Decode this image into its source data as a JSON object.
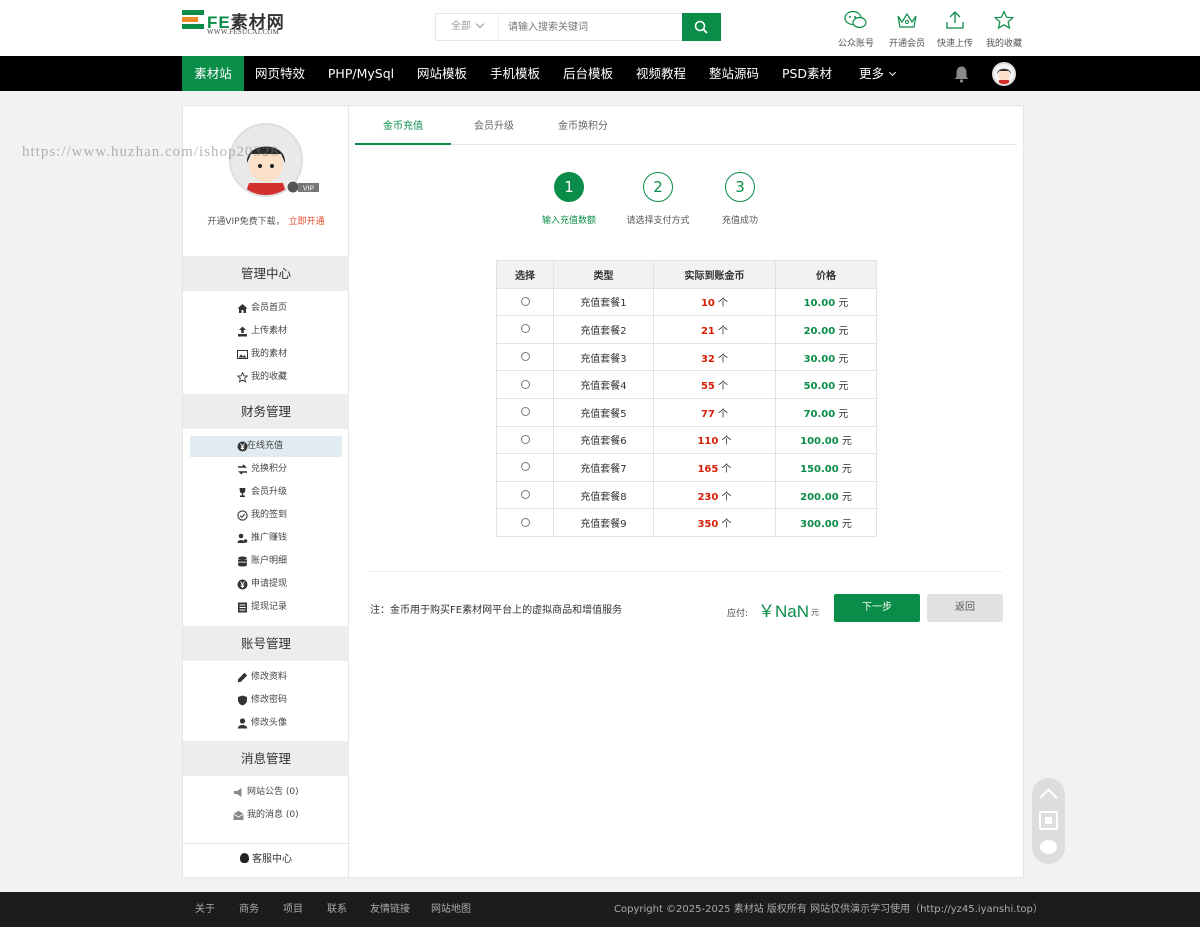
{
  "header": {
    "logo_text_fe": "FE",
    "logo_text_cn": "素材网",
    "logo_sub": "WWW.FESUCAI.COM",
    "search": {
      "category": "全部",
      "placeholder": "请输入搜索关键词"
    },
    "tools": [
      {
        "label": "公众账号",
        "icon": "wechat-icon"
      },
      {
        "label": "开通会员",
        "icon": "crown-icon"
      },
      {
        "label": "快速上传",
        "icon": "upload-icon"
      },
      {
        "label": "我的收藏",
        "icon": "star-icon"
      }
    ]
  },
  "nav": {
    "items": [
      "素材站",
      "网页特效",
      "PHP/MySql",
      "网站模板",
      "手机模板",
      "后台模板",
      "视频教程",
      "整站源码",
      "PSD素材",
      "更多"
    ],
    "active_index": 0
  },
  "sidebar": {
    "vip_tip": "开通VIP免费下载，",
    "vip_link": "立即开通",
    "vip_badge": "VIP",
    "sections": [
      {
        "title": "管理中心",
        "items": [
          "会员首页",
          "上传素材",
          "我的素材",
          "我的收藏"
        ]
      },
      {
        "title": "财务管理",
        "items": [
          "在线充值",
          "兑换积分",
          "会员升级",
          "我的签到",
          "推广赚钱",
          "账户明细",
          "申请提现",
          "提现记录"
        ]
      },
      {
        "title": "账号管理",
        "items": [
          "修改资料",
          "修改密码",
          "修改头像"
        ]
      },
      {
        "title": "消息管理",
        "items": [
          "网站公告 (0)",
          "我的消息 (0)"
        ]
      }
    ],
    "active_item": "在线充值",
    "service": "客服中心"
  },
  "tabs": [
    "金币充值",
    "会员升级",
    "金币换积分"
  ],
  "active_tab": 0,
  "steps": [
    {
      "num": "1",
      "label": "输入充值数额"
    },
    {
      "num": "2",
      "label": "请选择支付方式"
    },
    {
      "num": "3",
      "label": "充值成功"
    }
  ],
  "table": {
    "headers": [
      "选择",
      "类型",
      "实际到账金币",
      "价格"
    ],
    "coin_unit": "个",
    "price_unit": "元",
    "rows": [
      {
        "type": "充值套餐1",
        "coins": "10",
        "price": "10.00"
      },
      {
        "type": "充值套餐2",
        "coins": "21",
        "price": "20.00"
      },
      {
        "type": "充值套餐3",
        "coins": "32",
        "price": "30.00"
      },
      {
        "type": "充值套餐4",
        "coins": "55",
        "price": "50.00"
      },
      {
        "type": "充值套餐5",
        "coins": "77",
        "price": "70.00"
      },
      {
        "type": "充值套餐6",
        "coins": "110",
        "price": "100.00"
      },
      {
        "type": "充值套餐7",
        "coins": "165",
        "price": "150.00"
      },
      {
        "type": "充值套餐8",
        "coins": "230",
        "price": "200.00"
      },
      {
        "type": "充值套餐9",
        "coins": "350",
        "price": "300.00"
      }
    ]
  },
  "payment": {
    "note": "注：金币用于购买FE素材网平台上的虚拟商品和增值服务",
    "label": "应付:",
    "amount": "￥NaN",
    "unit": "元",
    "next": "下一步",
    "back": "返回"
  },
  "footer": {
    "links": [
      "关于",
      "商务",
      "项目",
      "联系",
      "友情链接",
      "网站地图"
    ],
    "copyright": "Copyright ©2025-2025 素材站 版权所有 网站仅供演示学习使用（http://yz45.iyanshi.top）"
  },
  "watermark": "https://www.huzhan.com/ishop20328",
  "colors": {
    "brand": "#0a8d48",
    "coin": "#d81e06",
    "logo_orange": "#f08a24"
  }
}
